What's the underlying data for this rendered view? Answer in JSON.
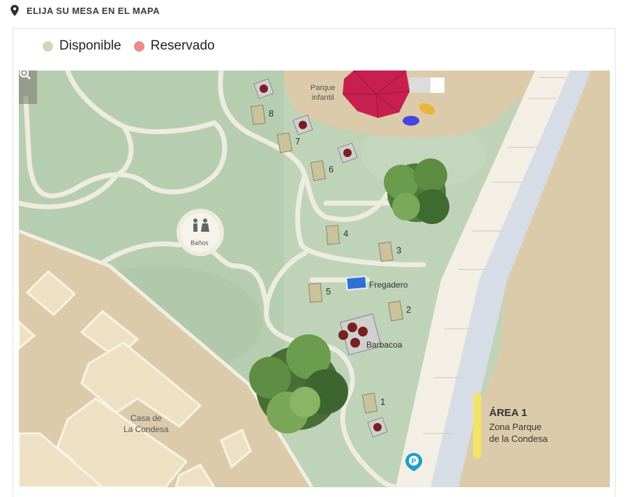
{
  "header": {
    "title": "ELIJA SU MESA EN EL MAPA",
    "icon": "map-pin-icon"
  },
  "legend": {
    "items": [
      {
        "label": "Disponible",
        "color": "#c5dcbb"
      },
      {
        "label": "Reservado",
        "color": "#f08b8b"
      }
    ]
  },
  "map": {
    "zoom": {
      "out_icon": "zoom-out-icon",
      "in_icon": "zoom-in-icon"
    },
    "areas": {
      "parque_infantil": "Parque\ninfantil",
      "banos": "Baños",
      "fregadero": "Fregadero",
      "barbacoa": "Barbacoa",
      "casa": "Casa de\nLa Condesa"
    },
    "tables": [
      "1",
      "2",
      "3",
      "4",
      "5",
      "6",
      "7",
      "8"
    ],
    "zone": {
      "title": "ÁREA 1",
      "subtitle_line1": "Zona Parque",
      "subtitle_line2": "de la Condesa"
    },
    "parking_icon": "parking-pin-icon",
    "colors": {
      "grass": "#bfd3b9",
      "path": "#f1eee3",
      "sand": "#dccbaa",
      "water": "#d6dde6",
      "table": "#c9c29a",
      "accent": "#f2e36b"
    }
  }
}
